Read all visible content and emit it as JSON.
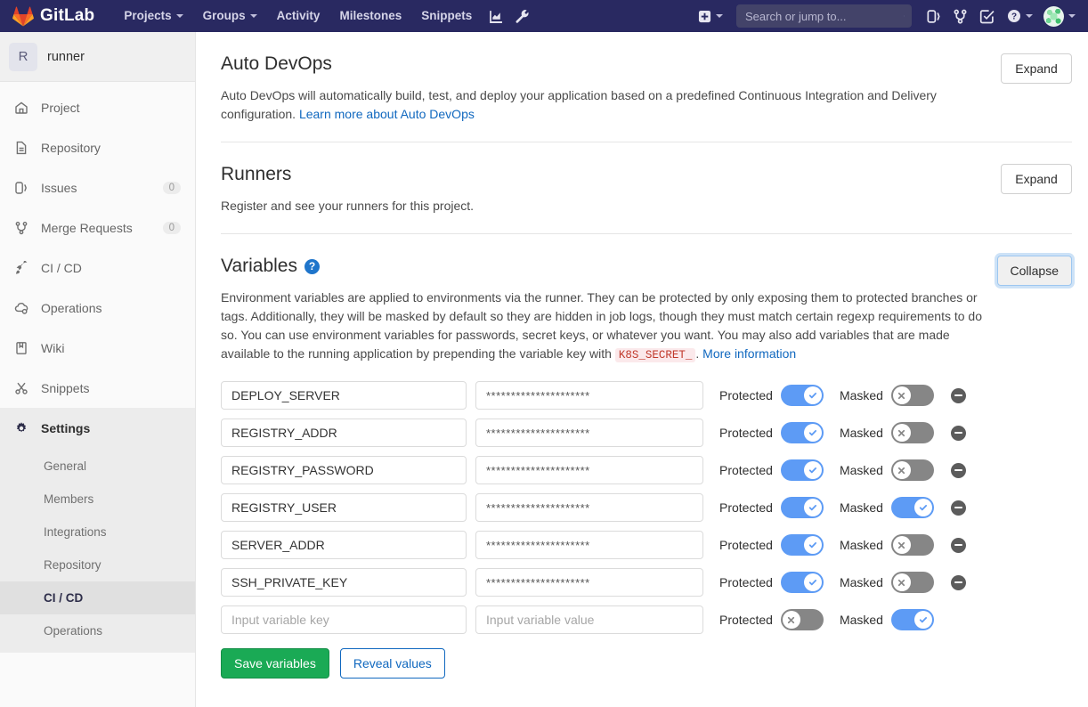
{
  "navbar": {
    "brand": "GitLab",
    "links": [
      {
        "label": "Projects",
        "caret": true,
        "name": "nav-projects"
      },
      {
        "label": "Groups",
        "caret": true,
        "name": "nav-groups"
      },
      {
        "label": "Activity",
        "caret": false,
        "name": "nav-activity"
      },
      {
        "label": "Milestones",
        "caret": false,
        "name": "nav-milestones"
      },
      {
        "label": "Snippets",
        "caret": false,
        "name": "nav-snippets"
      }
    ],
    "left_icons": [
      "analytics-icon",
      "wrench-icon"
    ],
    "right_icons": [
      "plus-icon",
      "issues-icon",
      "merge-requests-icon",
      "todos-icon",
      "help-icon"
    ],
    "search": {
      "placeholder": "Search or jump to...",
      "value": ""
    }
  },
  "sidebar": {
    "project": {
      "initial": "R",
      "name": "runner"
    },
    "items": [
      {
        "label": "Project",
        "icon": "home-icon",
        "count": ""
      },
      {
        "label": "Repository",
        "icon": "document-icon",
        "count": ""
      },
      {
        "label": "Issues",
        "icon": "issues-icon",
        "count": "0"
      },
      {
        "label": "Merge Requests",
        "icon": "merge-request-icon",
        "count": "0"
      },
      {
        "label": "CI / CD",
        "icon": "rocket-icon",
        "count": ""
      },
      {
        "label": "Operations",
        "icon": "cloud-gear-icon",
        "count": ""
      },
      {
        "label": "Wiki",
        "icon": "book-icon",
        "count": ""
      },
      {
        "label": "Snippets",
        "icon": "scissors-icon",
        "count": ""
      },
      {
        "label": "Settings",
        "icon": "gear-icon",
        "count": "",
        "active": true
      }
    ],
    "subitems": [
      {
        "label": "General"
      },
      {
        "label": "Members"
      },
      {
        "label": "Integrations"
      },
      {
        "label": "Repository"
      },
      {
        "label": "CI / CD",
        "active": true
      },
      {
        "label": "Operations"
      }
    ]
  },
  "sections": {
    "auto_devops": {
      "title": "Auto DevOps",
      "description": "Auto DevOps will automatically build, test, and deploy your application based on a predefined Continuous Integration and Delivery configuration. ",
      "link": "Learn more about Auto DevOps",
      "button": "Expand"
    },
    "runners": {
      "title": "Runners",
      "description": "Register and see your runners for this project.",
      "button": "Expand"
    },
    "variables": {
      "title": "Variables",
      "help_icon": "question-mark-icon",
      "button": "Collapse",
      "desc_part1": "Environment variables are applied to environments via the runner. They can be protected by only exposing them to protected branches or tags. Additionally, they will be masked by default so they are hidden in job logs, though they must match certain regexp requirements to do so. You can use environment variables for passwords, secret keys, or whatever you want. You may also add variables that are made available to the running application by prepending the variable key with ",
      "code_token": "K8S_SECRET_",
      "desc_part2": ". ",
      "more_info_link": "More information",
      "protected_label": "Protected",
      "masked_label": "Masked",
      "key_placeholder": "Input variable key",
      "value_placeholder": "Input variable value",
      "masked_value_display": "*********************",
      "rows": [
        {
          "key": "DEPLOY_SERVER",
          "value": "*********************",
          "protected": true,
          "masked": false,
          "removable": true
        },
        {
          "key": "REGISTRY_ADDR",
          "value": "*********************",
          "protected": true,
          "masked": false,
          "removable": true
        },
        {
          "key": "REGISTRY_PASSWORD",
          "value": "*********************",
          "protected": true,
          "masked": false,
          "removable": true
        },
        {
          "key": "REGISTRY_USER",
          "value": "*********************",
          "protected": true,
          "masked": true,
          "removable": true
        },
        {
          "key": "SERVER_ADDR",
          "value": "*********************",
          "protected": true,
          "masked": false,
          "removable": true
        },
        {
          "key": "SSH_PRIVATE_KEY",
          "value": "*********************",
          "protected": true,
          "masked": false,
          "removable": true
        },
        {
          "key": "",
          "value": "",
          "protected": false,
          "masked": true,
          "removable": false
        }
      ],
      "save_button": "Save variables",
      "reveal_button": "Reveal values"
    }
  },
  "colors": {
    "navbar_bg": "#292961",
    "accent_blue": "#1068bf",
    "toggle_on": "#5d9bf5",
    "toggle_off": "#868686",
    "save_green": "#1aaa55",
    "code_red": "#c0392b"
  }
}
